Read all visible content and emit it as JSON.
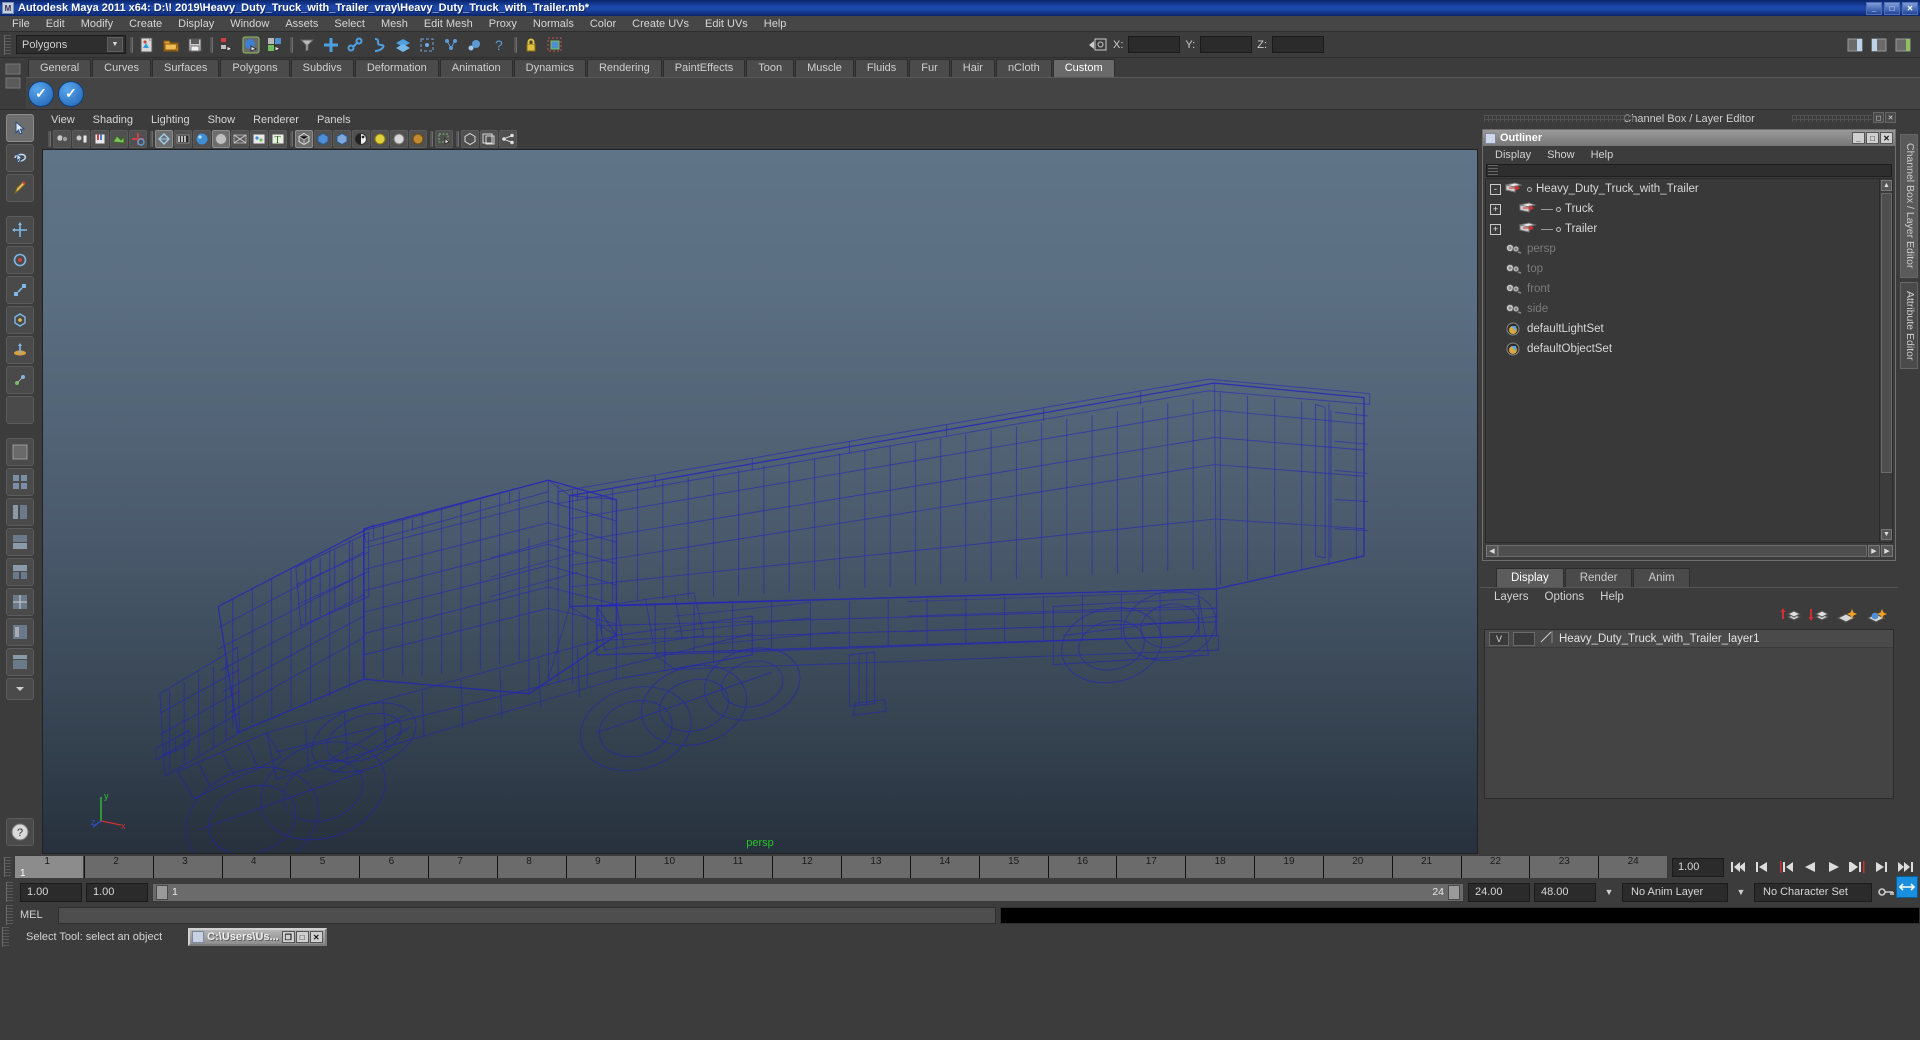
{
  "window": {
    "title": "Autodesk Maya 2011 x64: D:\\! 2019\\Heavy_Duty_Truck_with_Trailer_vray\\Heavy_Duty_Truck_with_Trailer.mb*",
    "minimize": "_",
    "maximize": "□",
    "close": "✕",
    "app_icon": "maya-icon"
  },
  "menubar": {
    "items": [
      "File",
      "Edit",
      "Modify",
      "Create",
      "Display",
      "Window",
      "Assets",
      "Select",
      "Mesh",
      "Edit Mesh",
      "Proxy",
      "Normals",
      "Color",
      "Create UVs",
      "Edit UVs",
      "Help"
    ]
  },
  "statusbar": {
    "mode": "Polygons",
    "coord_labels": [
      "X:",
      "Y:",
      "Z:"
    ],
    "coord_values": [
      "",
      "",
      ""
    ]
  },
  "shelf": {
    "tabs": [
      "General",
      "Curves",
      "Surfaces",
      "Polygons",
      "Subdivs",
      "Deformation",
      "Animation",
      "Dynamics",
      "Rendering",
      "PaintEffects",
      "Toon",
      "Muscle",
      "Fluids",
      "Fur",
      "Hair",
      "nCloth",
      "Custom"
    ],
    "active_tab": "Custom",
    "buttons": [
      "vray-shelf-icon-1",
      "vray-shelf-icon-2"
    ]
  },
  "viewport": {
    "menus": [
      "View",
      "Shading",
      "Lighting",
      "Show",
      "Renderer",
      "Panels"
    ],
    "camera_label": "persp",
    "axis_labels": {
      "x": "x",
      "y": "y",
      "z": "z"
    },
    "model": "Heavy_Duty_Truck_with_Trailer wireframe",
    "wire_color": "#2020c8"
  },
  "channelbox": {
    "header": "Channel Box / Layer Editor"
  },
  "outliner": {
    "title": "Outliner",
    "menus": [
      "Display",
      "Show",
      "Help"
    ],
    "items": [
      {
        "label": "Heavy_Duty_Truck_with_Trailer",
        "expander": "-",
        "icon": "transform-icon",
        "indent": 0,
        "dim": false
      },
      {
        "label": "Truck",
        "expander": "+",
        "icon": "transform-icon",
        "indent": 1,
        "dim": false
      },
      {
        "label": "Trailer",
        "expander": "+",
        "icon": "transform-icon",
        "indent": 1,
        "dim": false
      },
      {
        "label": "persp",
        "expander": "",
        "icon": "camera-icon",
        "indent": 0,
        "dim": true
      },
      {
        "label": "top",
        "expander": "",
        "icon": "camera-icon",
        "indent": 0,
        "dim": true
      },
      {
        "label": "front",
        "expander": "",
        "icon": "camera-icon",
        "indent": 0,
        "dim": true
      },
      {
        "label": "side",
        "expander": "",
        "icon": "camera-icon",
        "indent": 0,
        "dim": true
      },
      {
        "label": "defaultLightSet",
        "expander": "",
        "icon": "set-icon",
        "indent": 0,
        "dim": false
      },
      {
        "label": "defaultObjectSet",
        "expander": "",
        "icon": "set-icon",
        "indent": 0,
        "dim": false
      }
    ],
    "window_buttons": [
      "_",
      "□",
      "✕"
    ]
  },
  "layer_editor": {
    "tabs": [
      "Display",
      "Render",
      "Anim"
    ],
    "active_tab": "Display",
    "menus": [
      "Layers",
      "Options",
      "Help"
    ],
    "toolbar_icons": [
      "move-layer-up-icon",
      "move-layer-down-icon",
      "new-layer-icon",
      "new-layer-from-selected-icon"
    ],
    "layers": [
      {
        "visibility": "V",
        "playback": "",
        "name": "Heavy_Duty_Truck_with_Trailer_layer1"
      }
    ]
  },
  "right_tabs": {
    "items": [
      "Channel Box / Layer Editor",
      "Attribute Editor"
    ],
    "active": "Channel Box / Layer Editor"
  },
  "time_slider": {
    "ticks": [
      "1",
      "2",
      "3",
      "4",
      "5",
      "6",
      "7",
      "8",
      "9",
      "10",
      "11",
      "12",
      "13",
      "14",
      "15",
      "16",
      "17",
      "18",
      "19",
      "20",
      "21",
      "22",
      "23",
      "24"
    ],
    "current_frame_label": "1",
    "current_time_field": "1.00",
    "playback_buttons": [
      "go-to-start-icon",
      "step-back-keyframe-icon",
      "step-back-frame-icon",
      "play-backwards-icon",
      "play-forwards-icon",
      "step-forward-frame-icon",
      "step-forward-keyframe-icon",
      "go-to-end-icon"
    ]
  },
  "range_slider": {
    "anim_start": "1.00",
    "range_start": "1.00",
    "range_bar_start": "1",
    "range_bar_end": "24",
    "range_end": "24.00",
    "anim_end": "48.00",
    "anim_layer": "No Anim Layer",
    "character_set": "No Character Set"
  },
  "mel": {
    "label": "MEL",
    "input_value": "",
    "output_value": ""
  },
  "help_line": {
    "text": "Select Tool: select an object"
  },
  "taskbar": {
    "window_label": "C:\\Users\\Us...",
    "buttons": [
      "❐",
      "□",
      "✕"
    ]
  },
  "toolbox": {
    "items": [
      "select-tool",
      "lasso-select-tool",
      "paint-select-tool",
      "move-tool",
      "rotate-tool",
      "scale-tool",
      "universal-manipulator-tool",
      "soft-modification-tool",
      "show-manipulator-tool",
      "last-tool-used"
    ],
    "layouts": [
      "single-perspective-layout",
      "four-view-layout",
      "persp-outliner-layout",
      "persp-graph-layout",
      "hypershade-persp-layout",
      "persp-uv-layout",
      "two-pane-side-layout",
      "outliner-persp-layout",
      "custom-layout"
    ],
    "selected": "select-tool"
  }
}
